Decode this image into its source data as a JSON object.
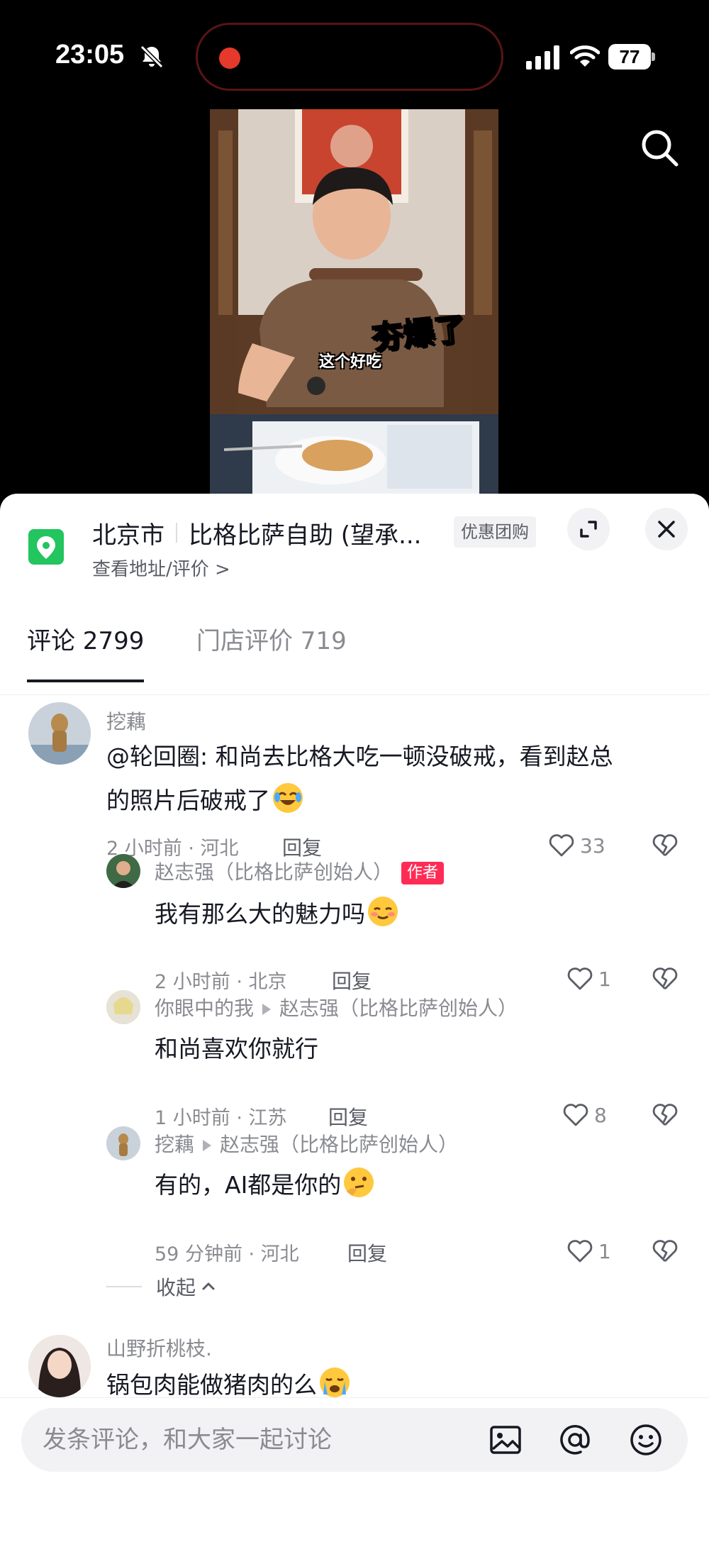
{
  "status_bar": {
    "time": "23:05",
    "battery": "77",
    "icons": [
      "bell-slash-icon",
      "signal-icon",
      "wifi-icon",
      "battery-icon"
    ]
  },
  "video": {
    "caption_big": "夯爆了",
    "caption_small": "这个好吃"
  },
  "poi": {
    "city": "北京市",
    "name": "比格比萨自助 (望承...",
    "tag": "优惠团购",
    "subtitle": "查看地址/评价 >"
  },
  "tabs": [
    {
      "label": "评论 2799",
      "active": true
    },
    {
      "label": "门店评价 719",
      "active": false
    }
  ],
  "comments": [
    {
      "user": "挖藕",
      "text_line1": "@轮回圈: 和尚去比格大吃一顿没破戒，看到赵总",
      "text_line2": "的照片后破戒了",
      "emoji": "laughing-tears-emoji",
      "meta": "2 小时前 · 河北",
      "reply": "回复",
      "likes": "33"
    },
    {
      "user": "赵志强（比格比萨创始人）",
      "badge": "作者",
      "text": "我有那么大的魅力吗",
      "emoji": "shy-smile-emoji",
      "meta": "2 小时前 · 北京",
      "reply": "回复",
      "likes": "1"
    },
    {
      "user": "你眼中的我",
      "reply_to": "赵志强（比格比萨创始人）",
      "text": "和尚喜欢你就行",
      "meta": "1 小时前 · 江苏",
      "reply": "回复",
      "likes": "8"
    },
    {
      "user": "挖藕",
      "reply_to": "赵志强（比格比萨创始人）",
      "text": "有的，AI都是你的",
      "emoji": "thinking-emoji",
      "meta": "59 分钟前 · 河北",
      "reply": "回复",
      "likes": "1"
    },
    {
      "user": "山野折桃枝.",
      "text": "锅包肉能做猪肉的么",
      "emoji": "crying-emoji"
    }
  ],
  "collapse_label": "收起",
  "input": {
    "placeholder": "发条评论，和大家一起讨论"
  },
  "colors": {
    "accent": "#fe2c55",
    "poi_green": "#22c55e",
    "text_primary": "#161823",
    "text_secondary": "#8a8b91"
  }
}
